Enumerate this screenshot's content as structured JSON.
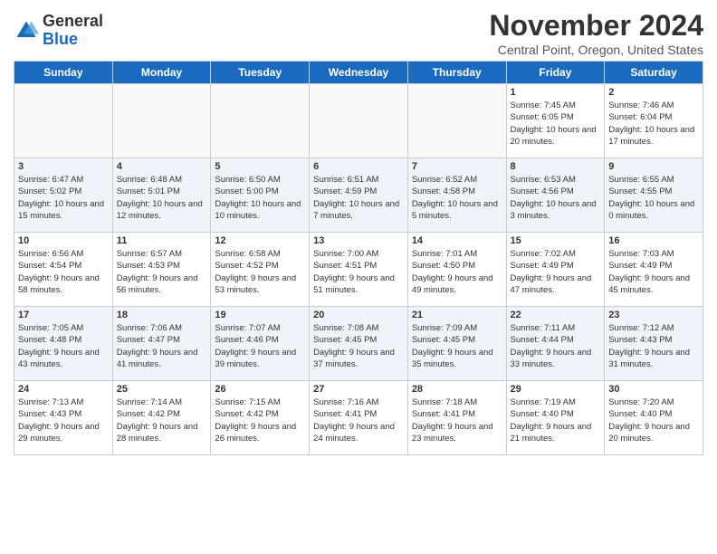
{
  "header": {
    "logo_general": "General",
    "logo_blue": "Blue",
    "title": "November 2024",
    "subtitle": "Central Point, Oregon, United States"
  },
  "columns": [
    "Sunday",
    "Monday",
    "Tuesday",
    "Wednesday",
    "Thursday",
    "Friday",
    "Saturday"
  ],
  "weeks": [
    [
      {
        "day": "",
        "info": ""
      },
      {
        "day": "",
        "info": ""
      },
      {
        "day": "",
        "info": ""
      },
      {
        "day": "",
        "info": ""
      },
      {
        "day": "",
        "info": ""
      },
      {
        "day": "1",
        "info": "Sunrise: 7:45 AM\nSunset: 6:05 PM\nDaylight: 10 hours and 20 minutes."
      },
      {
        "day": "2",
        "info": "Sunrise: 7:46 AM\nSunset: 6:04 PM\nDaylight: 10 hours and 17 minutes."
      }
    ],
    [
      {
        "day": "3",
        "info": "Sunrise: 6:47 AM\nSunset: 5:02 PM\nDaylight: 10 hours and 15 minutes."
      },
      {
        "day": "4",
        "info": "Sunrise: 6:48 AM\nSunset: 5:01 PM\nDaylight: 10 hours and 12 minutes."
      },
      {
        "day": "5",
        "info": "Sunrise: 6:50 AM\nSunset: 5:00 PM\nDaylight: 10 hours and 10 minutes."
      },
      {
        "day": "6",
        "info": "Sunrise: 6:51 AM\nSunset: 4:59 PM\nDaylight: 10 hours and 7 minutes."
      },
      {
        "day": "7",
        "info": "Sunrise: 6:52 AM\nSunset: 4:58 PM\nDaylight: 10 hours and 5 minutes."
      },
      {
        "day": "8",
        "info": "Sunrise: 6:53 AM\nSunset: 4:56 PM\nDaylight: 10 hours and 3 minutes."
      },
      {
        "day": "9",
        "info": "Sunrise: 6:55 AM\nSunset: 4:55 PM\nDaylight: 10 hours and 0 minutes."
      }
    ],
    [
      {
        "day": "10",
        "info": "Sunrise: 6:56 AM\nSunset: 4:54 PM\nDaylight: 9 hours and 58 minutes."
      },
      {
        "day": "11",
        "info": "Sunrise: 6:57 AM\nSunset: 4:53 PM\nDaylight: 9 hours and 56 minutes."
      },
      {
        "day": "12",
        "info": "Sunrise: 6:58 AM\nSunset: 4:52 PM\nDaylight: 9 hours and 53 minutes."
      },
      {
        "day": "13",
        "info": "Sunrise: 7:00 AM\nSunset: 4:51 PM\nDaylight: 9 hours and 51 minutes."
      },
      {
        "day": "14",
        "info": "Sunrise: 7:01 AM\nSunset: 4:50 PM\nDaylight: 9 hours and 49 minutes."
      },
      {
        "day": "15",
        "info": "Sunrise: 7:02 AM\nSunset: 4:49 PM\nDaylight: 9 hours and 47 minutes."
      },
      {
        "day": "16",
        "info": "Sunrise: 7:03 AM\nSunset: 4:49 PM\nDaylight: 9 hours and 45 minutes."
      }
    ],
    [
      {
        "day": "17",
        "info": "Sunrise: 7:05 AM\nSunset: 4:48 PM\nDaylight: 9 hours and 43 minutes."
      },
      {
        "day": "18",
        "info": "Sunrise: 7:06 AM\nSunset: 4:47 PM\nDaylight: 9 hours and 41 minutes."
      },
      {
        "day": "19",
        "info": "Sunrise: 7:07 AM\nSunset: 4:46 PM\nDaylight: 9 hours and 39 minutes."
      },
      {
        "day": "20",
        "info": "Sunrise: 7:08 AM\nSunset: 4:45 PM\nDaylight: 9 hours and 37 minutes."
      },
      {
        "day": "21",
        "info": "Sunrise: 7:09 AM\nSunset: 4:45 PM\nDaylight: 9 hours and 35 minutes."
      },
      {
        "day": "22",
        "info": "Sunrise: 7:11 AM\nSunset: 4:44 PM\nDaylight: 9 hours and 33 minutes."
      },
      {
        "day": "23",
        "info": "Sunrise: 7:12 AM\nSunset: 4:43 PM\nDaylight: 9 hours and 31 minutes."
      }
    ],
    [
      {
        "day": "24",
        "info": "Sunrise: 7:13 AM\nSunset: 4:43 PM\nDaylight: 9 hours and 29 minutes."
      },
      {
        "day": "25",
        "info": "Sunrise: 7:14 AM\nSunset: 4:42 PM\nDaylight: 9 hours and 28 minutes."
      },
      {
        "day": "26",
        "info": "Sunrise: 7:15 AM\nSunset: 4:42 PM\nDaylight: 9 hours and 26 minutes."
      },
      {
        "day": "27",
        "info": "Sunrise: 7:16 AM\nSunset: 4:41 PM\nDaylight: 9 hours and 24 minutes."
      },
      {
        "day": "28",
        "info": "Sunrise: 7:18 AM\nSunset: 4:41 PM\nDaylight: 9 hours and 23 minutes."
      },
      {
        "day": "29",
        "info": "Sunrise: 7:19 AM\nSunset: 4:40 PM\nDaylight: 9 hours and 21 minutes."
      },
      {
        "day": "30",
        "info": "Sunrise: 7:20 AM\nSunset: 4:40 PM\nDaylight: 9 hours and 20 minutes."
      }
    ]
  ]
}
